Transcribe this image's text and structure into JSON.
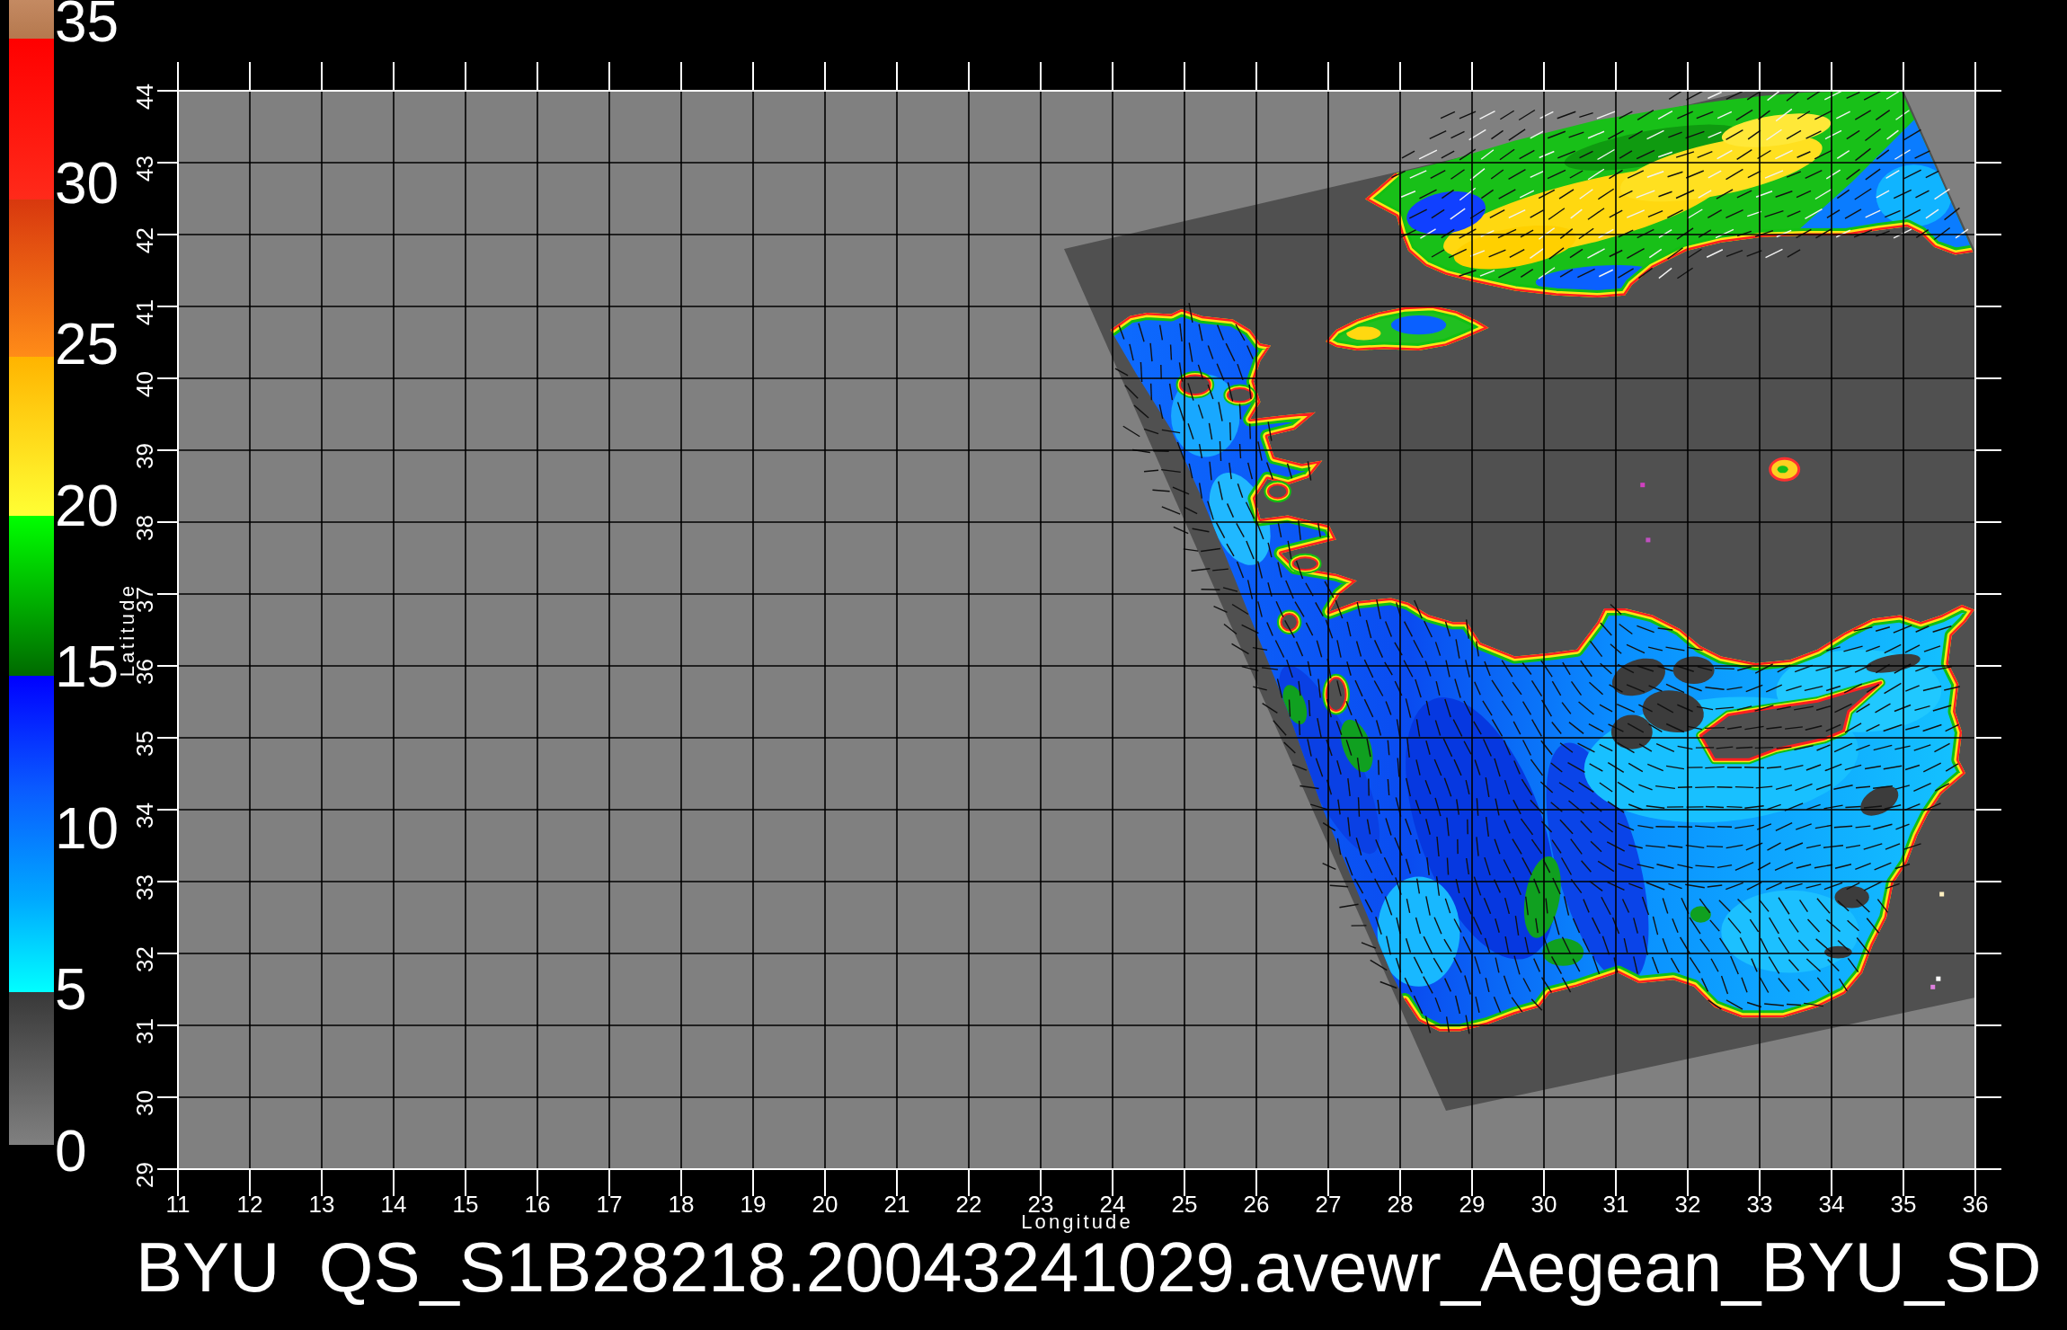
{
  "colorbar": {
    "labels": [
      "35",
      "30",
      "25",
      "20",
      "15",
      "10",
      "5",
      "0"
    ]
  },
  "y_axis": {
    "title": "Latitude",
    "ticks": [
      "44",
      "43",
      "42",
      "41",
      "40",
      "39",
      "38",
      "37",
      "36",
      "35",
      "34",
      "33",
      "32",
      "31",
      "30",
      "29"
    ]
  },
  "x_axis": {
    "ticks": [
      "11",
      "12",
      "13",
      "14",
      "15",
      "16",
      "17",
      "18",
      "19",
      "20",
      "21",
      "22",
      "23",
      "24",
      "25",
      "26",
      "27",
      "28",
      "29",
      "30",
      "31",
      "32",
      "33",
      "34",
      "35",
      "36"
    ],
    "title": "Longitude"
  },
  "title": "BYU  QS_S1B28218.20043241029.avewr_Aegean_BYU_SD"
}
